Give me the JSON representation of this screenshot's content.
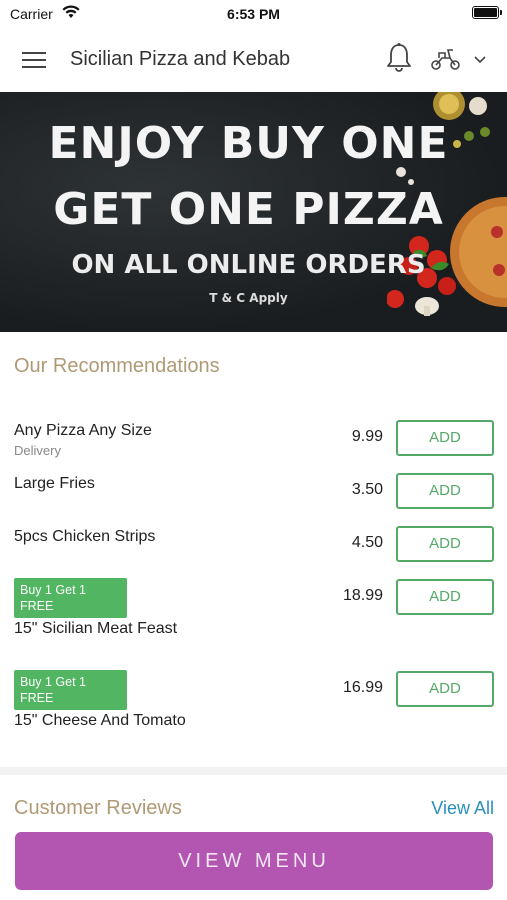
{
  "status_bar": {
    "carrier": "Carrier",
    "time": "6:53 PM"
  },
  "header": {
    "title": "Sicilian Pizza and Kebab",
    "icons": [
      "menu-icon",
      "bell-icon",
      "scooter-icon",
      "chevron-down-icon"
    ]
  },
  "banner": {
    "line1": "ENJOY BUY ONE",
    "line2": "GET ONE PIZZA",
    "line3": "ON ALL ONLINE ORDERS",
    "terms": "T & C Apply"
  },
  "recommendations": {
    "title": "Our Recommendations",
    "add_label": "ADD",
    "items": [
      {
        "name": "Any Pizza Any Size",
        "sub": "Delivery",
        "price": "9.99"
      },
      {
        "name": "Large Fries",
        "price": "3.50"
      },
      {
        "name": "5pcs Chicken Strips",
        "price": "4.50"
      },
      {
        "badge": "Buy 1 Get 1 FREE",
        "name": "15\" Sicilian Meat Feast",
        "price": "18.99"
      },
      {
        "badge": "Buy 1 Get 1 FREE",
        "name": "15\" Cheese And Tomato",
        "price": "16.99"
      }
    ]
  },
  "reviews": {
    "title": "Customer Reviews",
    "view_all": "View All"
  },
  "footer": {
    "view_menu": "VIEW MENU"
  },
  "colors": {
    "accent_purple": "#b356b1",
    "add_green": "#55a968",
    "badge_green": "#52b562",
    "section_gold": "#b09a75",
    "link_blue": "#2a8fbd"
  }
}
